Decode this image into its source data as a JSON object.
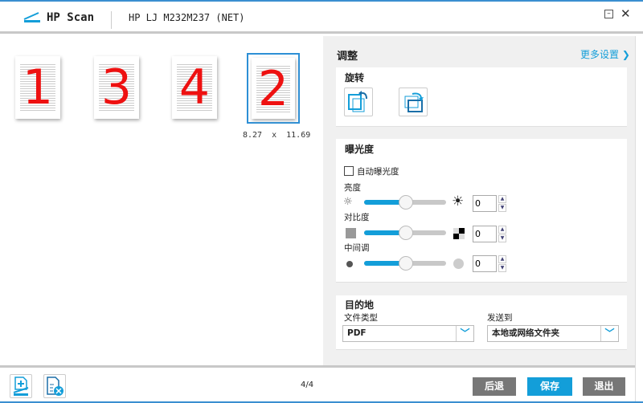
{
  "header": {
    "app_title": "HP Scan",
    "device": "HP LJ M232M237 (NET)"
  },
  "thumbnails": [
    {
      "label": "1"
    },
    {
      "label": "3"
    },
    {
      "label": "4"
    },
    {
      "label": "2",
      "selected": true
    }
  ],
  "selected_size": "8.27 x 11.69",
  "adjust": {
    "title": "调整",
    "more_settings": "更多设置",
    "rotate": {
      "title": "旋转",
      "buttons": [
        "rotate-left",
        "rotate-right"
      ]
    },
    "exposure": {
      "title": "曝光度",
      "auto_label": "自动曝光度",
      "auto_checked": false,
      "brightness": {
        "label": "亮度",
        "value": "0",
        "level": 50
      },
      "contrast": {
        "label": "对比度",
        "value": "0",
        "level": 50
      },
      "midtone": {
        "label": "中间调",
        "value": "0",
        "level": 50
      }
    },
    "destination": {
      "title": "目的地",
      "file_type_label": "文件类型",
      "file_type": "PDF",
      "send_to_label": "发送到",
      "send_to": "本地或网络文件夹"
    }
  },
  "footer": {
    "page": "4/4",
    "back": "后退",
    "save": "保存",
    "exit": "退出"
  },
  "colors": {
    "accent": "#139ed9",
    "gray_button": "#777777",
    "save_button": "#139ed9",
    "scribble": "#ee1111"
  }
}
